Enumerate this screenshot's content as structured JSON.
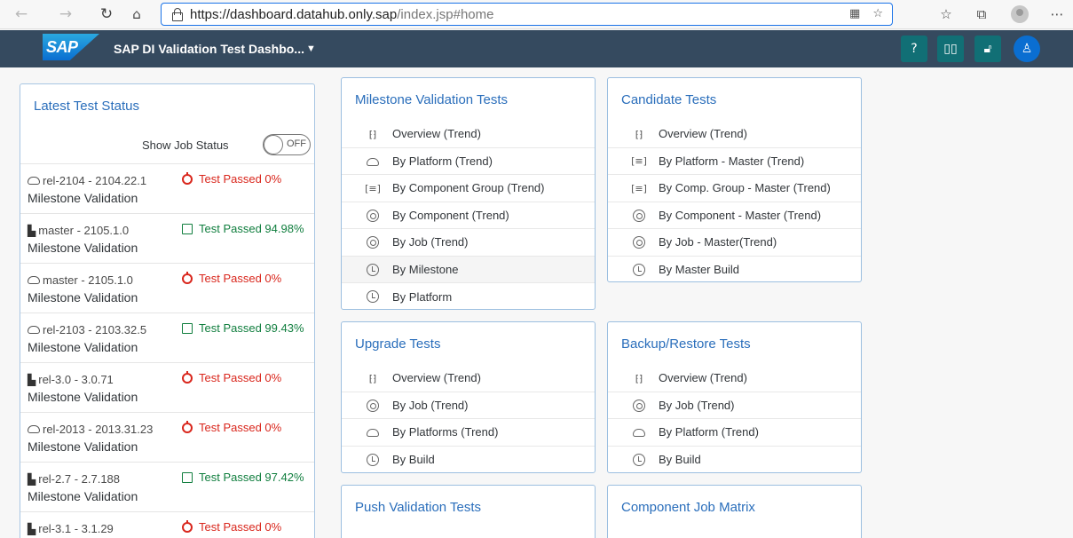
{
  "browser": {
    "url_host": "https://dashboard.datahub.only.sap",
    "url_path": "/index.jsp#home"
  },
  "header": {
    "logo": "SAP",
    "title": "SAP DI Validation Test Dashbo...",
    "caret": "▼",
    "colors": {
      "bar": "#354a5f",
      "button": "#116f75",
      "user": "#0a6ed1"
    }
  },
  "status_panel": {
    "title": "Latest Test Status",
    "show_job_label": "Show Job Status",
    "toggle_text": "OFF",
    "rows": [
      {
        "release": "rel-2104 - 2104.22.1",
        "kind": "Milestone Validation",
        "result": "Test Passed 0%"
      },
      {
        "release": "master - 2105.1.0",
        "kind": "Milestone Validation",
        "result": "Test Passed 94.98%"
      },
      {
        "release": "master - 2105.1.0",
        "kind": "Milestone Validation",
        "result": "Test Passed 0%"
      },
      {
        "release": "rel-2103 - 2103.32.5",
        "kind": "Milestone Validation",
        "result": "Test Passed 99.43%"
      },
      {
        "release": "rel-3.0 - 3.0.71",
        "kind": "Milestone Validation",
        "result": "Test Passed 0%"
      },
      {
        "release": "rel-2013 - 2013.31.23",
        "kind": "Milestone Validation",
        "result": "Test Passed 0%"
      },
      {
        "release": "rel-2.7 - 2.7.188",
        "kind": "Milestone Validation",
        "result": "Test Passed 97.42%"
      },
      {
        "release": "rel-3.1 - 3.1.29",
        "kind": "",
        "result": "Test Passed 0%"
      }
    ]
  },
  "cards": {
    "milestone": {
      "title": "Milestone Validation Tests",
      "items": [
        "Overview (Trend)",
        "By Platform (Trend)",
        "By Component Group (Trend)",
        "By Component (Trend)",
        "By Job (Trend)",
        "By Milestone",
        "By Platform"
      ]
    },
    "candidate": {
      "title": "Candidate Tests",
      "items": [
        "Overview (Trend)",
        "By Platform - Master (Trend)",
        "By Comp. Group - Master (Trend)",
        "By Component - Master (Trend)",
        "By Job - Master(Trend)",
        "By Master Build"
      ]
    },
    "upgrade": {
      "title": "Upgrade Tests",
      "items": [
        "Overview (Trend)",
        "By Job (Trend)",
        "By Platforms (Trend)",
        "By Build"
      ]
    },
    "backup": {
      "title": "Backup/Restore Tests",
      "items": [
        "Overview (Trend)",
        "By Job (Trend)",
        "By Platform (Trend)",
        "By Build"
      ]
    },
    "push": {
      "title": "Push Validation Tests"
    },
    "matrix": {
      "title": "Component Job Matrix"
    }
  }
}
